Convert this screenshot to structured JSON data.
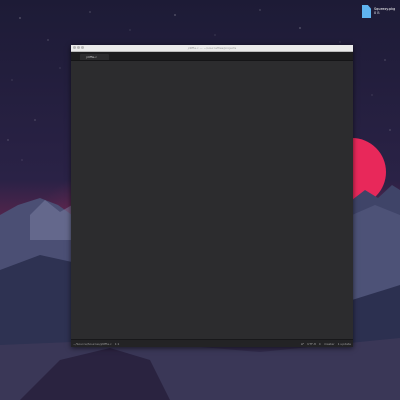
{
  "desktop": {
    "icon_name": "file-icon",
    "icon_label": "Squeezy.pkg",
    "icon_sublabel": "8 B"
  },
  "window": {
    "title": "jdiffie.c — ~/sourcefiles/projects",
    "tab_label": "jdiffie.c",
    "status": {
      "path": "~/Source/Sources/jdiffie.c",
      "line_col": "1:1",
      "encoding": "UTF-8",
      "line_ending": "LF",
      "language": "C",
      "git": "master",
      "updates": "1 update"
    }
  },
  "colors": {
    "sky_top": "#1e1c3a",
    "sky_bottom": "#5a2a55",
    "sun": "#e8285a",
    "mountain": "#3a3f63",
    "window_bg": "#2c2c2e"
  }
}
